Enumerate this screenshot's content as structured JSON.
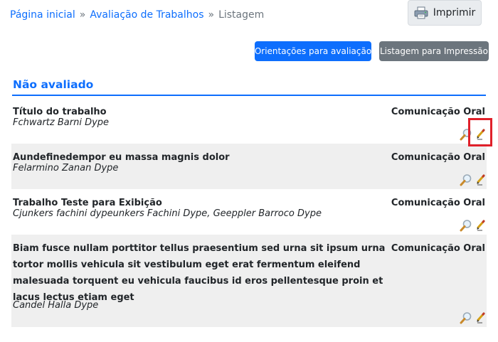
{
  "breadcrumb": {
    "home": "Página inicial",
    "separator": "»",
    "section": "Avaliação de Trabalhos",
    "current": "Listagem"
  },
  "toolbar": {
    "print_label": "Imprimir",
    "orientations_label": "Orientações para avaliação",
    "print_list_label": "Listagem para Impressão"
  },
  "section": {
    "title": "Não avaliado"
  },
  "works": [
    {
      "title": "Título do trabalho",
      "authors": "Fchwartz Barni Dype",
      "type": "Comunicação Oral"
    },
    {
      "title": "Aundefinedempor eu massa magnis dolor",
      "authors": "Felarmino Zanan Dype",
      "type": "Comunicação Oral"
    },
    {
      "title": "Trabalho Teste para Exibição",
      "authors": "Cjunkers fachini dypeunkers Fachini Dype, Geeppler Barroco Dype",
      "type": "Comunicação Oral"
    },
    {
      "title": "Biam fusce nullam porttitor tellus praesentium sed urna sit ipsum urna tortor mollis vehicula sit vestibulum eget erat fermentum eleifend malesuada torquent eu vehicula faucibus id eros pellentesque proin et lacus lectus etiam eget",
      "authors": "Candel Halla Dype",
      "type": "Comunicação Oral"
    }
  ],
  "icons": {
    "view": "magnifier-icon",
    "edit": "pencil-icon",
    "print": "printer-icon"
  },
  "colors": {
    "primary": "#0d6efd",
    "secondary": "#6c757d",
    "highlight": "#e0202a",
    "row_alt": "#efefef"
  }
}
